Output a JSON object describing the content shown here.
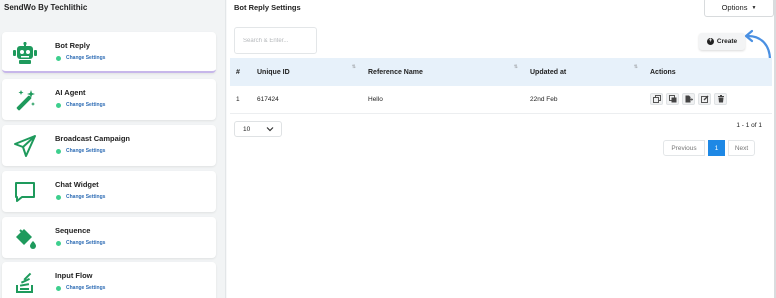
{
  "app": {
    "title": "SendWo By Techlithic"
  },
  "sidebar": {
    "items": [
      {
        "label": "Bot Reply",
        "status": "Change Settings",
        "icon": "robot-icon",
        "active": true
      },
      {
        "label": "AI Agent",
        "status": "Change Settings",
        "icon": "magic-wand-icon",
        "active": false
      },
      {
        "label": "Broadcast Campaign",
        "status": "Change Settings",
        "icon": "paper-plane-icon",
        "active": false
      },
      {
        "label": "Chat Widget",
        "status": "Change Settings",
        "icon": "chat-bubble-icon",
        "active": false
      },
      {
        "label": "Sequence",
        "status": "Change Settings",
        "icon": "paint-bucket-icon",
        "active": false
      },
      {
        "label": "Input Flow",
        "status": "Change Settings",
        "icon": "stack-overflow-icon",
        "active": false
      }
    ]
  },
  "main": {
    "title": "Bot Reply Settings",
    "options_label": "Options",
    "search_placeholder": "Search & Enter...",
    "create_label": "Create",
    "table": {
      "headers": [
        "#",
        "Unique ID",
        "Reference Name",
        "Updated at",
        "Actions"
      ],
      "rows": [
        {
          "index": "1",
          "unique_id": "617424",
          "reference_name": "Hello",
          "updated_at": "22nd Feb"
        }
      ]
    },
    "page_size": "10",
    "page_count": "1 - 1 of 1",
    "pagination": {
      "previous": "Previous",
      "current": "1",
      "next": "Next"
    }
  },
  "colors": {
    "accent": "#1e88e5",
    "status_green": "#3ecf8e",
    "icon_green": "#1e9a5c",
    "header_bg": "#e7f1fa"
  }
}
